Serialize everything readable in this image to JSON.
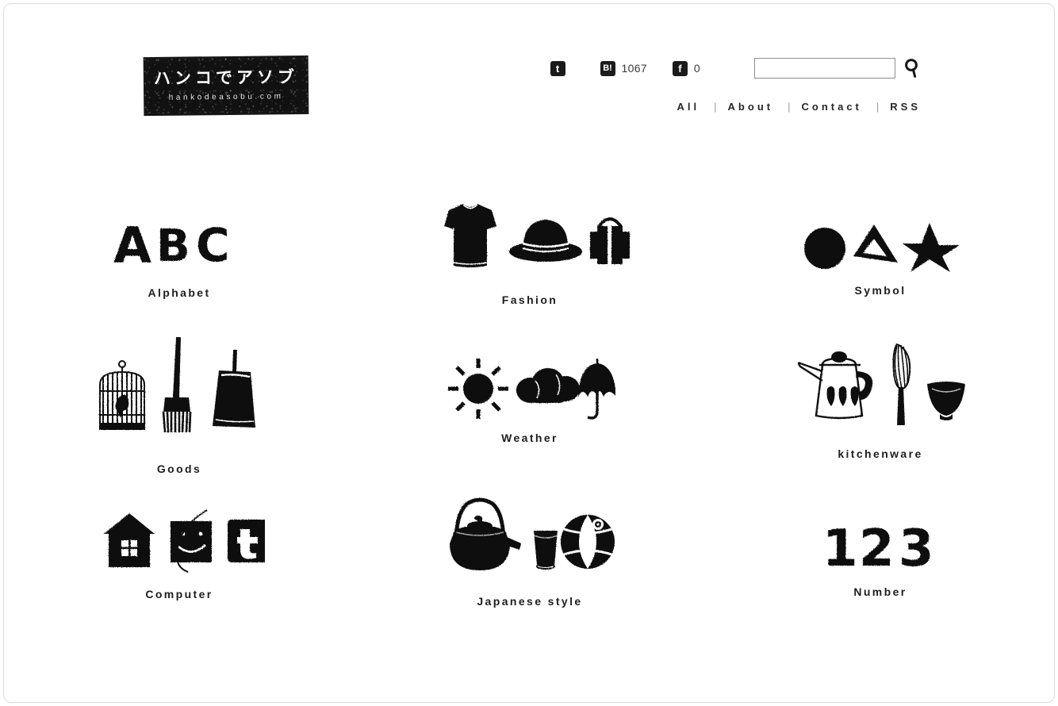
{
  "site": {
    "logo_main": "ハンコでアソブ",
    "logo_sub": "hankodeasobu.com"
  },
  "header": {
    "social": [
      {
        "id": "twitter",
        "icon": "twitter-icon",
        "glyph": "t",
        "count": ""
      },
      {
        "id": "hatena",
        "icon": "hatena-bookmark-icon",
        "glyph": "B!",
        "count": "1067"
      },
      {
        "id": "facebook",
        "icon": "facebook-icon",
        "glyph": "f",
        "count": "0"
      }
    ],
    "search": {
      "value": "",
      "placeholder": "",
      "button_icon": "search-icon"
    },
    "nav": [
      {
        "label": "All"
      },
      {
        "label": "About"
      },
      {
        "label": "Contact"
      },
      {
        "label": "RSS"
      }
    ],
    "nav_separator": "|"
  },
  "categories": [
    {
      "label": "Alphabet",
      "art": "abc-stamp",
      "items": "A B C"
    },
    {
      "label": "Fashion",
      "art": "fashion-stamp",
      "items": "t-shirt, hat, suitcase"
    },
    {
      "label": "Symbol",
      "art": "symbol-stamp",
      "items": "circle, triangle, star"
    },
    {
      "label": "Goods",
      "art": "goods-stamp",
      "items": "birdcage, broom, dustpan"
    },
    {
      "label": "Weather",
      "art": "weather-stamp",
      "items": "sun, cloud, umbrella"
    },
    {
      "label": "kitchenware",
      "art": "kitchenware-stamp",
      "items": "kettle, whisk, bowl"
    },
    {
      "label": "Computer",
      "art": "computer-stamp",
      "items": "house, face, twitter"
    },
    {
      "label": "Japanese style",
      "art": "japanese-stamp",
      "items": "teapot, teacup, temari ball"
    },
    {
      "label": "Number",
      "art": "number-stamp",
      "items": "1 2 3"
    }
  ],
  "colors": {
    "ink": "#121212",
    "page_background": "#ffffff",
    "frame_border": "#dcdcdc",
    "text": "#1e1e1e"
  }
}
